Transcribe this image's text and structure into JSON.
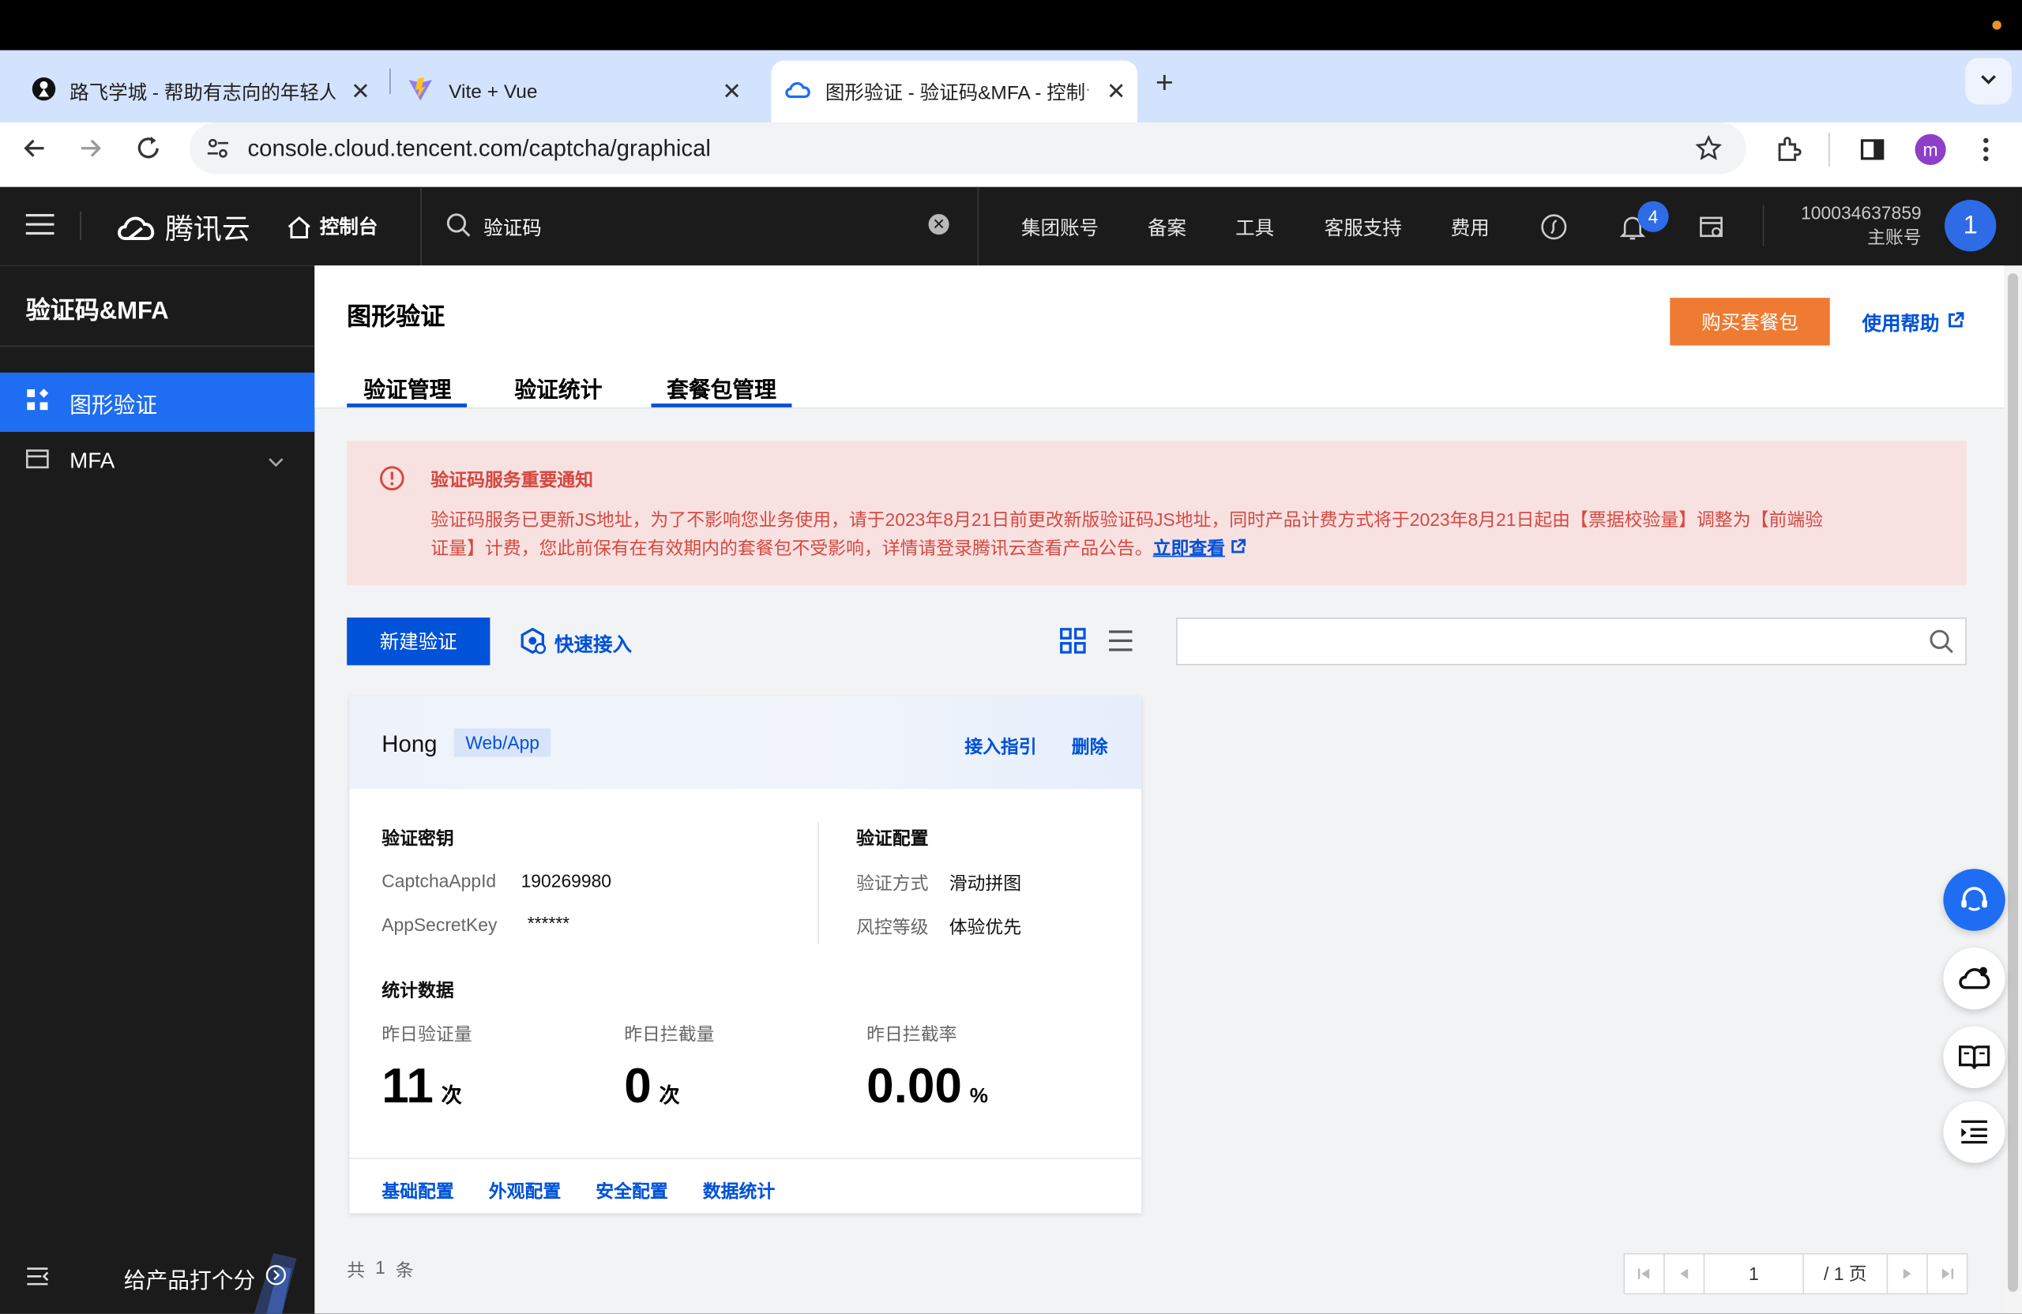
{
  "browser": {
    "tabs": [
      {
        "title": "路飞学城 - 帮助有志向的年轻人"
      },
      {
        "title": "Vite + Vue"
      },
      {
        "title": "图形验证 - 验证码&MFA - 控制台"
      }
    ],
    "url": "console.cloud.tencent.com/captcha/graphical",
    "profile_initial": "m"
  },
  "header": {
    "brand": "腾讯云",
    "console": "控制台",
    "search_value": "验证码",
    "nav": [
      "集团账号",
      "备案",
      "工具",
      "客服支持",
      "费用"
    ],
    "notification_count": "4",
    "account_id": "100034637859",
    "account_role": "主账号",
    "avatar_initial": "1"
  },
  "sidebar": {
    "title": "验证码&MFA",
    "items": [
      {
        "label": "图形验证"
      },
      {
        "label": "MFA"
      }
    ],
    "feedback": "给产品打个分"
  },
  "page": {
    "title": "图形验证",
    "buy_button": "购买套餐包",
    "help_link": "使用帮助",
    "tabs": [
      "验证管理",
      "验证统计",
      "套餐包管理"
    ]
  },
  "notice": {
    "title": "验证码服务重要通知",
    "line1": "验证码服务已更新JS地址，为了不影响您业务使用，请于2023年8月21日前更改新版验证码JS地址，同时产品计费方式将于2023年8月21日起由【票据校验量】调整为【前端验",
    "line2": "证量】计费，您此前保有在有效期内的套餐包不受影响，详情请登录腾讯云查看产品公告。",
    "link": "立即查看"
  },
  "toolbar": {
    "create_button": "新建验证",
    "quick_access": "快速接入"
  },
  "card": {
    "name": "Hong",
    "tag": "Web/App",
    "guide_link": "接入指引",
    "delete_link": "删除",
    "key_section": "验证密钥",
    "appid_label": "CaptchaAppId",
    "appid_value": "190269980",
    "secret_label": "AppSecretKey",
    "secret_value": "******",
    "config_section": "验证配置",
    "method_label": "验证方式",
    "method_value": "滑动拼图",
    "risk_label": "风控等级",
    "risk_value": "体验优先",
    "stats_section": "统计数据",
    "stats": [
      {
        "label": "昨日验证量",
        "value": "11",
        "unit": "次"
      },
      {
        "label": "昨日拦截量",
        "value": "0",
        "unit": "次"
      },
      {
        "label": "昨日拦截率",
        "value": "0.00",
        "unit": "%"
      }
    ],
    "footer_links": [
      "基础配置",
      "外观配置",
      "安全配置",
      "数据统计"
    ]
  },
  "pagination": {
    "total_prefix": "共",
    "total_count": "1",
    "total_suffix": "条",
    "current_page": "1",
    "page_total": "/ 1 页"
  },
  "colors": {
    "primary": "#0052d9",
    "orange": "#ee7b31",
    "danger": "#d54941",
    "notice_bg": "#f8e1e1",
    "dark_bg": "#1b1b1b"
  }
}
